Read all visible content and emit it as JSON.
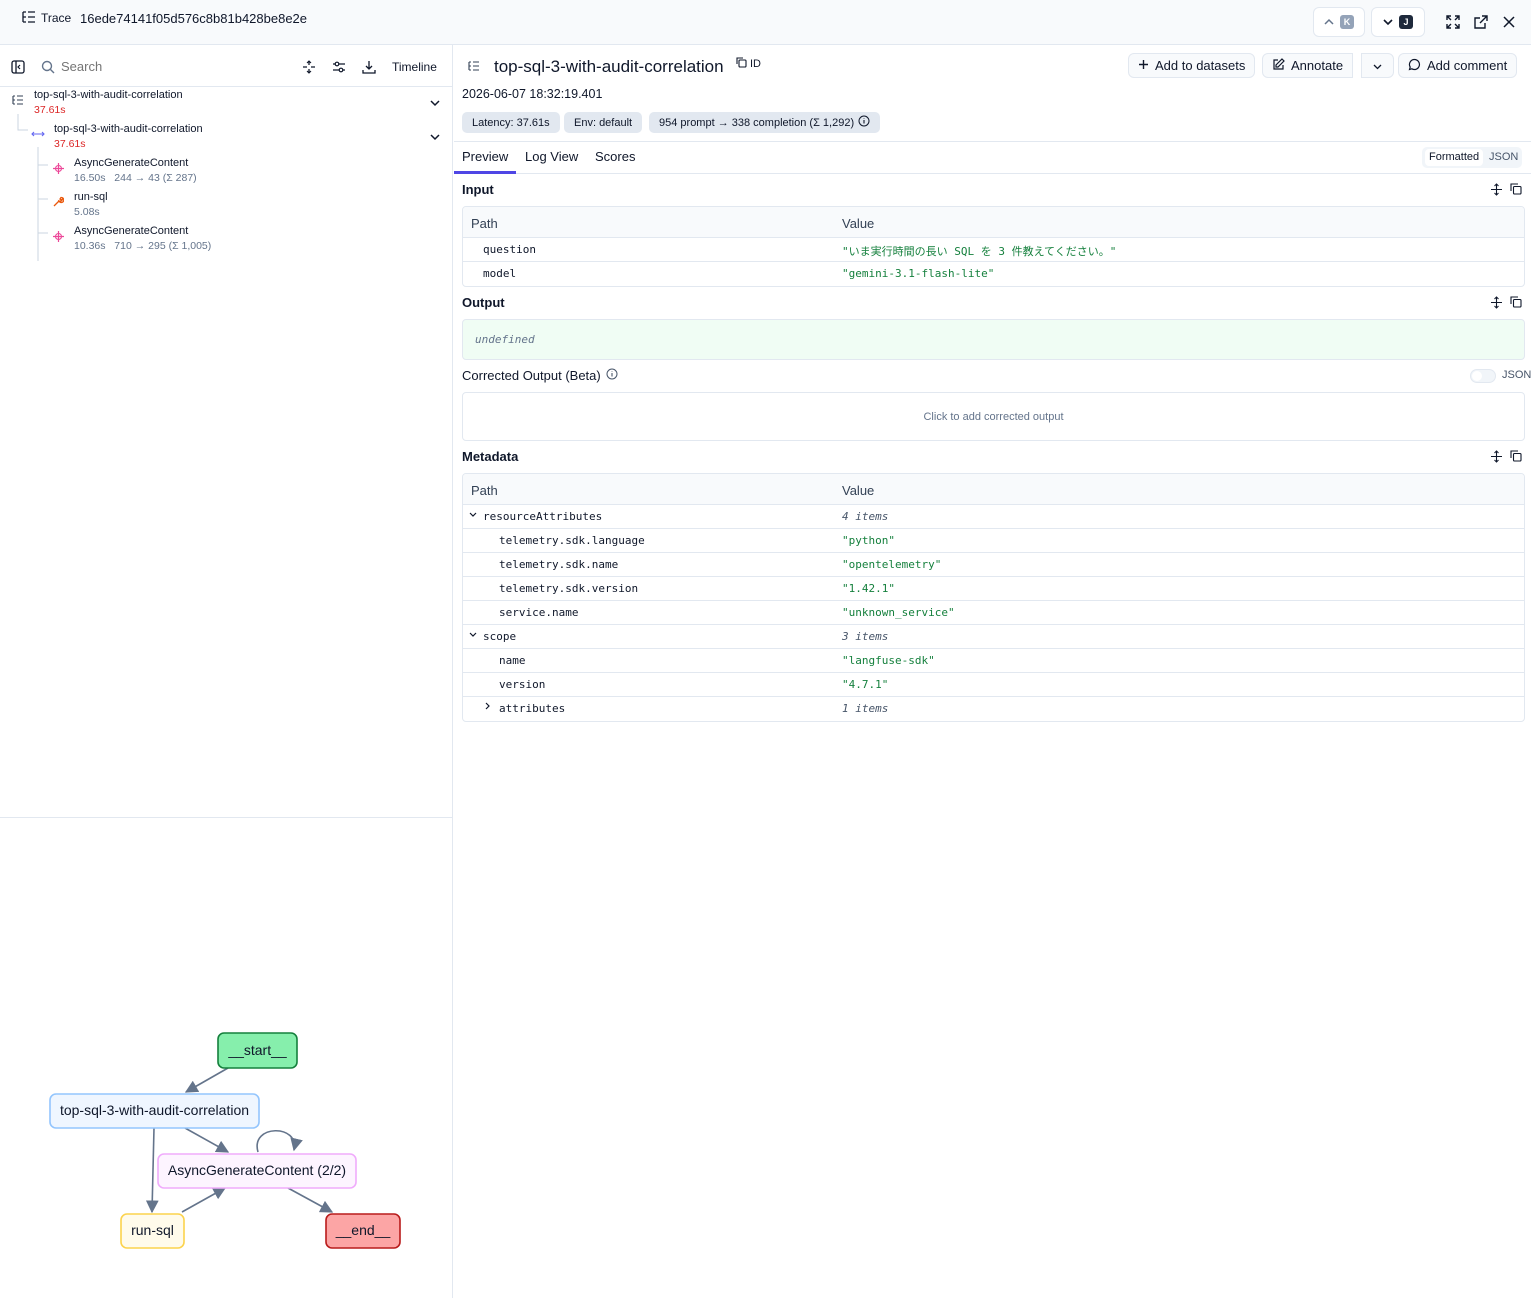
{
  "topbar": {
    "trace_label": "Trace",
    "trace_id": "16ede74141f05d576c8b81b428be8e2e",
    "prev_key": "K",
    "next_key": "J"
  },
  "left": {
    "search_placeholder": "Search",
    "timeline_label": "Timeline",
    "tree": [
      {
        "name": "top-sql-3-with-audit-correlation",
        "duration": "37.61s",
        "kind": "trace"
      },
      {
        "name": "top-sql-3-with-audit-correlation",
        "duration": "37.61s",
        "kind": "span"
      },
      {
        "name": "AsyncGenerateContent",
        "duration": "16.50s",
        "tokens": "244 → 43 (Σ 287)",
        "kind": "generation"
      },
      {
        "name": "run-sql",
        "duration": "5.08s",
        "kind": "tool"
      },
      {
        "name": "AsyncGenerateContent",
        "duration": "10.36s",
        "tokens": "710 → 295 (Σ 1,005)",
        "kind": "generation"
      }
    ],
    "graph": {
      "start": "__start__",
      "span": "top-sql-3-with-audit-correlation",
      "gen": "AsyncGenerateContent (2/2)",
      "tool": "run-sql",
      "end": "__end__"
    }
  },
  "detail": {
    "title": "top-sql-3-with-audit-correlation",
    "id_label": "ID",
    "actions": {
      "add_to_datasets": "Add to datasets",
      "annotate": "Annotate",
      "add_comment": "Add comment"
    },
    "timestamp": "2026-06-07 18:32:19.401",
    "badges": {
      "latency": "Latency: 37.61s",
      "env": "Env: default",
      "tokens": "954 prompt → 338 completion (Σ 1,292)"
    },
    "tabs": [
      "Preview",
      "Log View",
      "Scores"
    ],
    "view": {
      "formatted": "Formatted",
      "json": "JSON"
    },
    "input": {
      "title": "Input",
      "col_path": "Path",
      "col_value": "Value",
      "rows": [
        {
          "key": "question",
          "value": "\"いま実行時間の長い SQL を 3 件教えてください。\""
        },
        {
          "key": "model",
          "value": "\"gemini-3.1-flash-lite\""
        }
      ]
    },
    "output": {
      "title": "Output",
      "value": "undefined"
    },
    "corrected": {
      "title": "Corrected Output (Beta)",
      "json_label": "JSON",
      "placeholder": "Click to add corrected output"
    },
    "metadata": {
      "title": "Metadata",
      "col_path": "Path",
      "col_value": "Value",
      "rows": [
        {
          "key": "resourceAttributes",
          "value": "4 items",
          "group": true,
          "expanded": true
        },
        {
          "key": "telemetry.sdk.language",
          "value": "\"python\""
        },
        {
          "key": "telemetry.sdk.name",
          "value": "\"opentelemetry\""
        },
        {
          "key": "telemetry.sdk.version",
          "value": "\"1.42.1\""
        },
        {
          "key": "service.name",
          "value": "\"unknown_service\""
        },
        {
          "key": "scope",
          "value": "3 items",
          "group": true,
          "expanded": true
        },
        {
          "key": "name",
          "value": "\"langfuse-sdk\""
        },
        {
          "key": "version",
          "value": "\"4.7.1\""
        },
        {
          "key": "attributes",
          "value": "1 items",
          "group": true,
          "expanded": false
        }
      ]
    }
  },
  "colors": {
    "accent": "#4f46e5",
    "value_green": "#15803d",
    "duration_red": "#dc2626",
    "start_node": "#86efac",
    "end_node": "#fca5a5"
  }
}
